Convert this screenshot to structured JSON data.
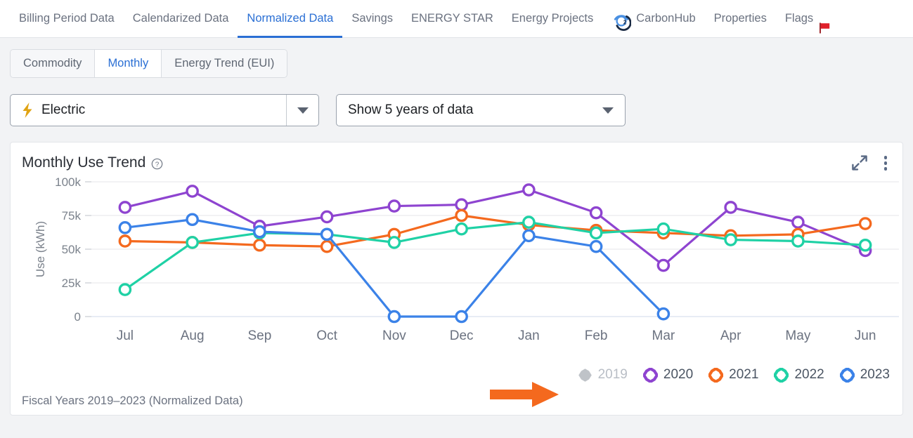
{
  "topnav": {
    "items": [
      {
        "label": "Billing Period Data",
        "active": false,
        "icon": null
      },
      {
        "label": "Calendarized Data",
        "active": false,
        "icon": null
      },
      {
        "label": "Normalized Data",
        "active": true,
        "icon": null
      },
      {
        "label": "Savings",
        "active": false,
        "icon": null
      },
      {
        "label": "ENERGY STAR",
        "active": false,
        "icon": null
      },
      {
        "label": "Energy Projects",
        "active": false,
        "icon": null
      },
      {
        "label": "CarbonHub",
        "active": false,
        "icon": "carbonhub-icon"
      },
      {
        "label": "Properties",
        "active": false,
        "icon": null
      },
      {
        "label": "Flags",
        "active": false,
        "icon": "red-flag-icon"
      }
    ]
  },
  "subtabs": {
    "items": [
      {
        "label": "Commodity",
        "active": false
      },
      {
        "label": "Monthly",
        "active": true
      },
      {
        "label": "Energy Trend (EUI)",
        "active": false
      }
    ]
  },
  "filters": {
    "commodity": {
      "value": "Electric",
      "icon": "lightning-bolt-icon"
    },
    "years": {
      "value": "Show 5 years of data"
    }
  },
  "card": {
    "title": "Monthly Use Trend",
    "help_icon": "question-mark-icon",
    "expand_icon": "expand-arrows-icon",
    "menu_icon": "kebab-menu-icon",
    "footer": "Fiscal Years 2019–2023 (Normalized Data)"
  },
  "annotation": {
    "type": "orange-arrow",
    "color": "#f4691e",
    "points_at": "2019"
  },
  "colors": {
    "accent": "#2a6fd4",
    "2019": "#bfc3c8",
    "2020": "#8e44d0",
    "2021": "#f4691e",
    "2022": "#1fd1a5",
    "2023": "#3b82e8",
    "bolt": "#e0a313",
    "flag": "#e0202a"
  },
  "chart_data": {
    "type": "line",
    "title": "Monthly Use Trend",
    "xlabel": "",
    "ylabel": "Use (kWh)",
    "ylim": [
      0,
      100000
    ],
    "yticks": [
      0,
      25000,
      50000,
      75000,
      100000
    ],
    "ytick_labels": [
      "0",
      "25k",
      "50k",
      "75k",
      "100k"
    ],
    "grid": true,
    "legend_position": "bottom-right",
    "categories": [
      "Jul",
      "Aug",
      "Sep",
      "Oct",
      "Nov",
      "Dec",
      "Jan",
      "Feb",
      "Mar",
      "Apr",
      "May",
      "Jun"
    ],
    "series": [
      {
        "name": "2019",
        "color": "#bfc3c8",
        "visible": false,
        "values": [
          null,
          null,
          null,
          null,
          null,
          null,
          null,
          null,
          null,
          null,
          null,
          null
        ]
      },
      {
        "name": "2020",
        "color": "#8e44d0",
        "visible": true,
        "values": [
          81000,
          93000,
          67000,
          74000,
          82000,
          83000,
          94000,
          77000,
          38000,
          81000,
          70000,
          49000
        ]
      },
      {
        "name": "2021",
        "color": "#f4691e",
        "visible": true,
        "values": [
          56000,
          55000,
          53000,
          52000,
          61000,
          75000,
          68000,
          64000,
          62000,
          60000,
          61000,
          69000
        ]
      },
      {
        "name": "2022",
        "color": "#1fd1a5",
        "visible": true,
        "values": [
          20000,
          55000,
          62000,
          61000,
          55000,
          65000,
          70000,
          62000,
          65000,
          57000,
          56000,
          53000
        ]
      },
      {
        "name": "2023",
        "color": "#3b82e8",
        "visible": true,
        "values": [
          66000,
          72000,
          63000,
          61000,
          0,
          0,
          60000,
          52000,
          2000,
          null,
          null,
          null
        ]
      }
    ]
  }
}
